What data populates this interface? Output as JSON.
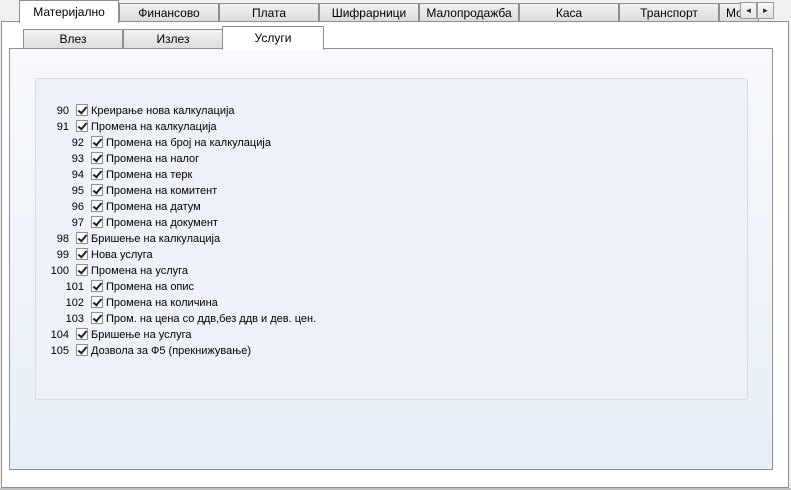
{
  "top_tabs": [
    "Материјално",
    "Финансово",
    "Плата",
    "Шифрарници",
    "Малопродажба",
    "Каса",
    "Транспорт",
    "Мо"
  ],
  "active_top_tab": "Материјално",
  "scroll": {
    "left": "◄",
    "right": "►"
  },
  "sub_tabs": [
    "Влез",
    "Излез",
    "Услуги"
  ],
  "active_sub_tab": "Услуги",
  "permissions": [
    {
      "num": "90",
      "label": "Креирање нова калкулација",
      "level": 0,
      "checked": true
    },
    {
      "num": "91",
      "label": "Промена на калкулација",
      "level": 0,
      "checked": true
    },
    {
      "num": "92",
      "label": "Промена на број на калкулација",
      "level": 1,
      "checked": true
    },
    {
      "num": "93",
      "label": "Промена на налог",
      "level": 1,
      "checked": true
    },
    {
      "num": "94",
      "label": "Промена на терк",
      "level": 1,
      "checked": true
    },
    {
      "num": "95",
      "label": "Промена на комитент",
      "level": 1,
      "checked": true
    },
    {
      "num": "96",
      "label": "Промена на датум",
      "level": 1,
      "checked": true
    },
    {
      "num": "97",
      "label": "Промена на документ",
      "level": 1,
      "checked": true
    },
    {
      "num": "98",
      "label": "Бришење на калкулација",
      "level": 0,
      "checked": true
    },
    {
      "num": "99",
      "label": "Нова услуга",
      "level": 0,
      "checked": true
    },
    {
      "num": "100",
      "label": "Промена на услуга",
      "level": 0,
      "checked": true
    },
    {
      "num": "101",
      "label": "Промена на опис",
      "level": 1,
      "checked": true
    },
    {
      "num": "102",
      "label": "Промена на количина",
      "level": 1,
      "checked": true
    },
    {
      "num": "103",
      "label": "Пром. на цена со ддв,без ддв и дев. цен.",
      "level": 1,
      "checked": true
    },
    {
      "num": "104",
      "label": "Бришење на услуга",
      "level": 0,
      "checked": true
    },
    {
      "num": "105",
      "label": "Дозвола за Ф5 (прекнижување)",
      "level": 0,
      "checked": true
    }
  ]
}
